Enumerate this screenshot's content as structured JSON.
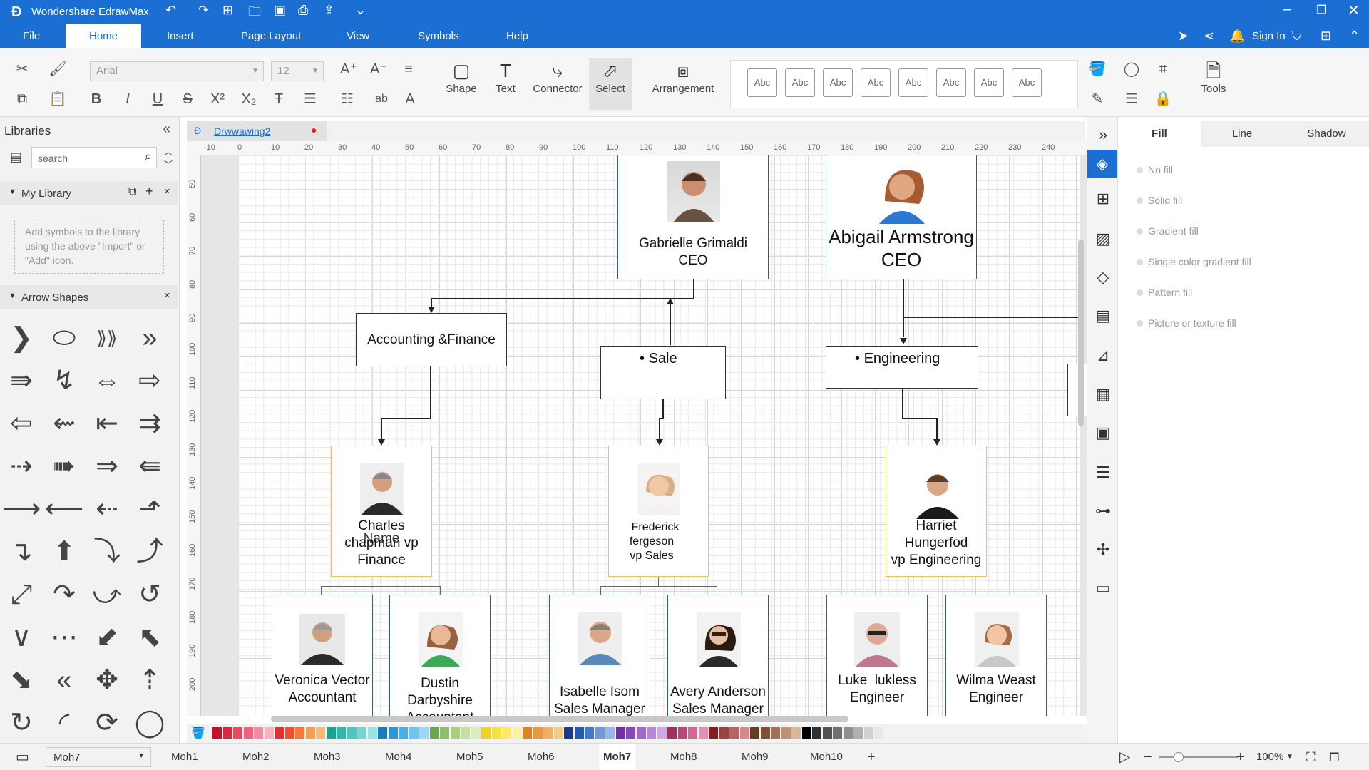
{
  "app": {
    "title": "Wondershare EdrawMax",
    "sign_in": "Sign In"
  },
  "menu": [
    "File",
    "Home",
    "Insert",
    "Page Layout",
    "View",
    "Symbols",
    "Help"
  ],
  "ribbon": {
    "font": "Arial",
    "size": "12",
    "shape": "Shape",
    "text": "Text",
    "connector": "Connector",
    "select": "Select",
    "arrangement": "Arrangement",
    "tools": "Tools",
    "style_label": "Abc"
  },
  "libraries": {
    "title": "Libraries",
    "search_placeholder": "search",
    "my_library": "My Library",
    "hint": "Add symbols to the library using the above \"Import\" or \"Add\" icon.",
    "arrow_shapes": "Arrow Shapes"
  },
  "document": {
    "tab": "Drwwawing2"
  },
  "ruler_top": [
    "-10",
    "0",
    "10",
    "20",
    "30",
    "40",
    "50",
    "60",
    "70",
    "80",
    "90",
    "100",
    "110",
    "120",
    "130",
    "140",
    "150",
    "160",
    "170",
    "180",
    "190",
    "200",
    "210",
    "220",
    "230",
    "240"
  ],
  "ruler_left": [
    "50",
    "60",
    "70",
    "80",
    "90",
    "100",
    "110",
    "120",
    "130",
    "140",
    "150",
    "160",
    "170",
    "180",
    "190",
    "200"
  ],
  "org": {
    "ceo1_name": "Gabrielle Grimaldi",
    "ceo1_title": "CEO",
    "ceo2_name": "Abigail Armstrong",
    "ceo2_title": "CEO",
    "dept_acc": "Accounting &Finance",
    "dept_sale": "Sale",
    "dept_eng": "Engineering",
    "vp1_l1": "Charles",
    "vp1_l2": "chapman",
    "vp1_l3": "Finance",
    "vp1_overlap": "Name",
    "vp1_overlap2": "vp",
    "vp2_l1": "Frederick",
    "vp2_l2": "fergeson",
    "vp2_l3": "vp Sales",
    "vp3_l1": "Harriet",
    "vp3_l2": "Hungerfod",
    "vp3_l3": "vp Engineering",
    "s1_name": "Veronica Vector",
    "s1_title": "Accountant",
    "s2_name": "Dustin",
    "s2_title": "Darbyshire",
    "s2_extra": "Accountant",
    "s3_name": "Isabelle Isom",
    "s3_title": "Sales Manager",
    "s4_name": "Avery Anderson",
    "s4_title": "Sales Manager",
    "s5_name": "Luke  lukless",
    "s5_title": "Engineer",
    "s6_name": "Wilma Weast",
    "s6_title": "Engineer"
  },
  "props": {
    "tabs": [
      "Fill",
      "Line",
      "Shadow"
    ],
    "options": [
      "No fill",
      "Solid fill",
      "Gradient fill",
      "Single color gradient fill",
      "Pattern fill",
      "Picture or texture fill"
    ]
  },
  "palette": [
    "#c8102e",
    "#e0283c",
    "#e84a5f",
    "#f06080",
    "#f48aa0",
    "#f8b0c0",
    "#e03030",
    "#f05030",
    "#f47a3c",
    "#f89c50",
    "#fbb870",
    "#20a090",
    "#30b8a8",
    "#48c8c0",
    "#70d8d0",
    "#98e4e0",
    "#1a7cc0",
    "#2a98d8",
    "#48b0e8",
    "#70c4f0",
    "#98d8f8",
    "#6aa84f",
    "#8cc060",
    "#a8d080",
    "#c4e0a0",
    "#dcecc0",
    "#f0d020",
    "#f8e040",
    "#fce870",
    "#fdf0a0",
    "#e08020",
    "#e89840",
    "#f0b060",
    "#f8c888",
    "#1a3c8c",
    "#2a58b0",
    "#4878c8",
    "#7098d8",
    "#98b8e8",
    "#7030a0",
    "#8848b8",
    "#a068c8",
    "#b888d8",
    "#d0a8e8",
    "#a03060",
    "#b84878",
    "#d06890",
    "#e090b0",
    "#802020",
    "#a04040",
    "#c06060",
    "#d88888",
    "#604020",
    "#805030",
    "#a07050",
    "#c09070",
    "#d8b898",
    "#000000",
    "#303030",
    "#505050",
    "#707070",
    "#909090",
    "#b0b0b0",
    "#d0d0d0",
    "#e8e8e8"
  ],
  "pages": {
    "current": "Moh7",
    "tabs": [
      "Moh1",
      "Moh2",
      "Moh3",
      "Moh4",
      "Moh5",
      "Moh6",
      "Moh7",
      "Moh8",
      "Moh9",
      "Moh10"
    ],
    "zoom": "100%"
  }
}
